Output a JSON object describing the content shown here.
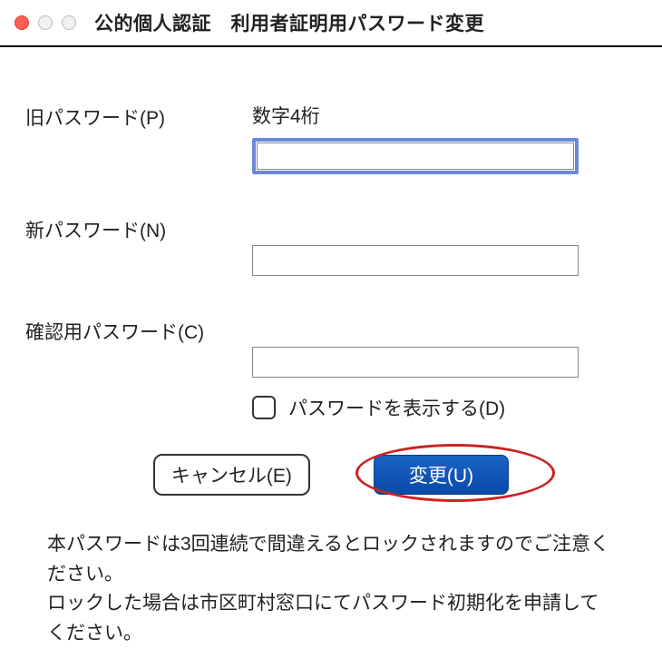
{
  "window": {
    "title": "公的個人認証　利用者証明用パスワード変更"
  },
  "form": {
    "old_label": "旧パスワード(P)",
    "old_hint": "数字4桁",
    "new_label": "新パスワード(N)",
    "confirm_label": "確認用パスワード(C)",
    "show_label": "パスワードを表示する(D)"
  },
  "buttons": {
    "cancel": "キャンセル(E)",
    "change": "変更(U)"
  },
  "notice": {
    "line1": "本パスワードは3回連続で間違えるとロックされますのでご注意ください。",
    "line2": "ロックした場合は市区町村窓口にてパスワード初期化を申請してください。"
  }
}
